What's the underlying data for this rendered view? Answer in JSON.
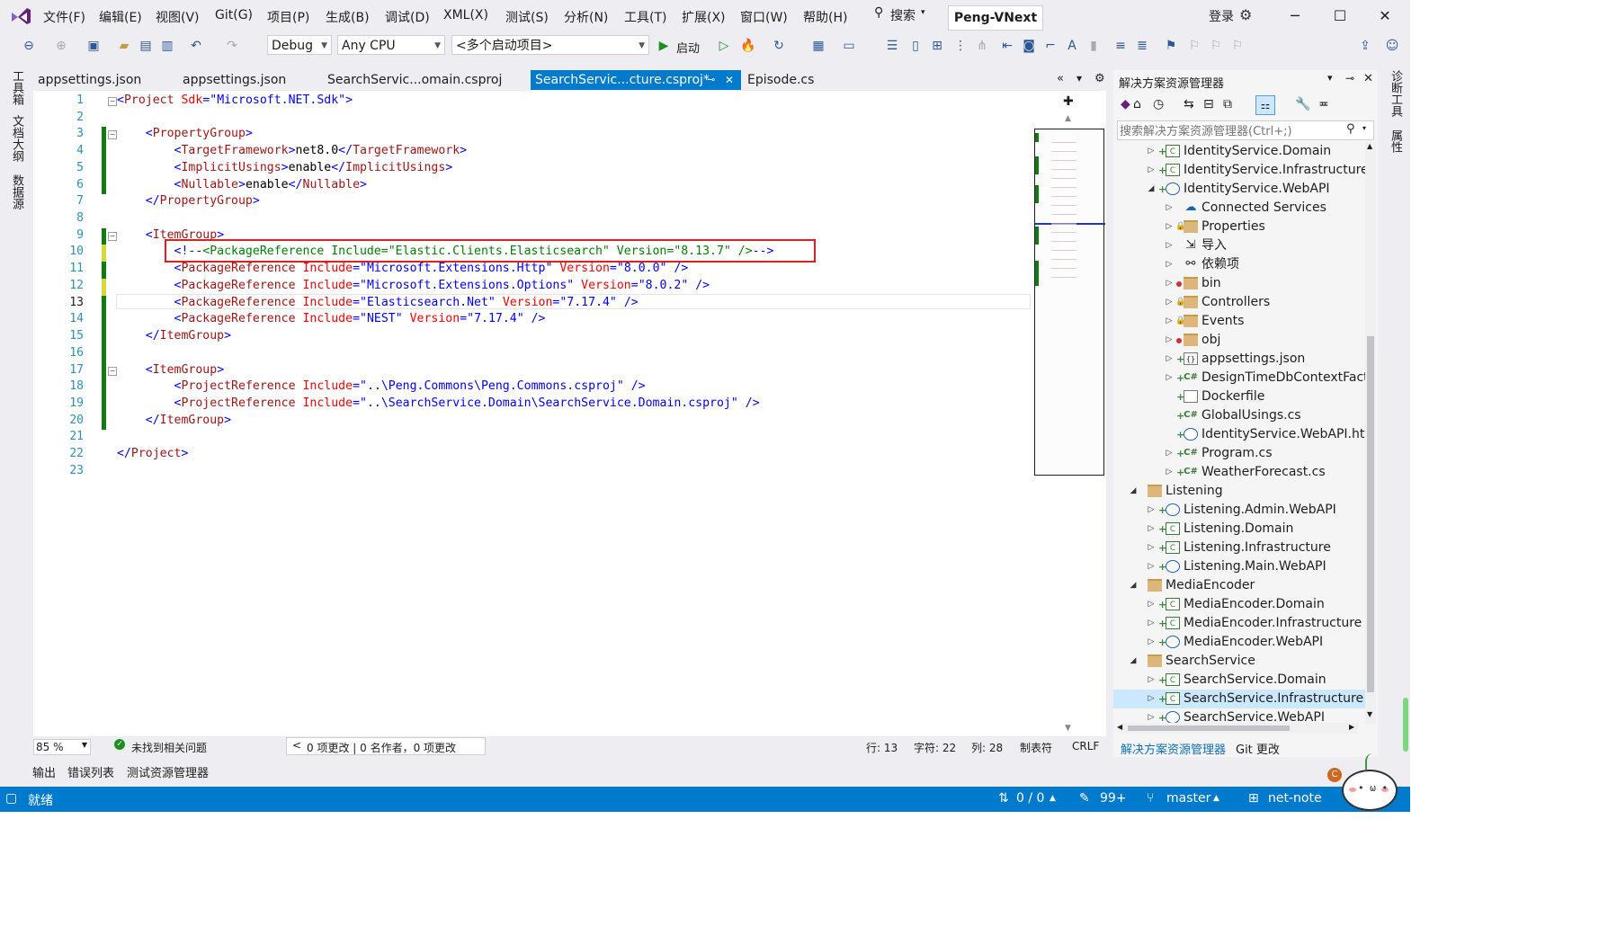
{
  "menu": {
    "items": [
      "文件(F)",
      "编辑(E)",
      "视图(V)",
      "Git(G)",
      "项目(P)",
      "生成(B)",
      "调试(D)",
      "XML(X)",
      "测试(S)",
      "分析(N)",
      "工具(T)",
      "扩展(X)",
      "窗口(W)",
      "帮助(H)"
    ],
    "search": "搜索",
    "solution_name": "Peng-VNext",
    "login": "登录"
  },
  "toolbar": {
    "config": "Debug",
    "platform": "Any CPU",
    "startup": "<多个启动项目>",
    "start_label": "启动"
  },
  "left_strip": {
    "tabs": [
      "工具箱",
      "文档大纲",
      "数据源"
    ]
  },
  "right_strip": {
    "tabs": [
      "诊断工具",
      "属性"
    ]
  },
  "doc_tabs": [
    {
      "label": "appsettings.json"
    },
    {
      "label": "appsettings.json"
    },
    {
      "label": "SearchServic...omain.csproj"
    },
    {
      "label": "SearchServic...cture.csproj*"
    },
    {
      "label": "Episode.cs"
    }
  ],
  "editor": {
    "line_numbers": [
      "1",
      "2",
      "3",
      "4",
      "5",
      "6",
      "7",
      "8",
      "9",
      "10",
      "11",
      "12",
      "13",
      "14",
      "15",
      "16",
      "17",
      "18",
      "19",
      "20",
      "21",
      "22",
      "23"
    ],
    "lines": [
      [
        [
          "br",
          "<"
        ],
        [
          "tag",
          "Project"
        ],
        [
          "attr",
          " Sdk"
        ],
        [
          "br",
          "="
        ],
        [
          "val",
          "\"Microsoft.NET.Sdk\""
        ],
        [
          "br",
          ">"
        ]
      ],
      [],
      [
        [
          "txt",
          "    "
        ],
        [
          "br",
          "<"
        ],
        [
          "tag",
          "PropertyGroup"
        ],
        [
          "br",
          ">"
        ]
      ],
      [
        [
          "txt",
          "        "
        ],
        [
          "br",
          "<"
        ],
        [
          "tag",
          "TargetFramework"
        ],
        [
          "br",
          ">"
        ],
        [
          "txt",
          "net8.0"
        ],
        [
          "br",
          "</"
        ],
        [
          "tag",
          "TargetFramework"
        ],
        [
          "br",
          ">"
        ]
      ],
      [
        [
          "txt",
          "        "
        ],
        [
          "br",
          "<"
        ],
        [
          "tag",
          "ImplicitUsings"
        ],
        [
          "br",
          ">"
        ],
        [
          "txt",
          "enable"
        ],
        [
          "br",
          "</"
        ],
        [
          "tag",
          "ImplicitUsings"
        ],
        [
          "br",
          ">"
        ]
      ],
      [
        [
          "txt",
          "        "
        ],
        [
          "br",
          "<"
        ],
        [
          "tag",
          "Nullable"
        ],
        [
          "br",
          ">"
        ],
        [
          "txt",
          "enable"
        ],
        [
          "br",
          "</"
        ],
        [
          "tag",
          "Nullable"
        ],
        [
          "br",
          ">"
        ]
      ],
      [
        [
          "txt",
          "    "
        ],
        [
          "br",
          "</"
        ],
        [
          "tag",
          "PropertyGroup"
        ],
        [
          "br",
          ">"
        ]
      ],
      [],
      [
        [
          "txt",
          "    "
        ],
        [
          "br",
          "<"
        ],
        [
          "tag",
          "ItemGroup"
        ],
        [
          "br",
          ">"
        ]
      ],
      [
        [
          "txt",
          "        "
        ],
        [
          "br",
          "<!--"
        ],
        [
          "cmt",
          "<PackageReference Include=\"Elastic.Clients.Elasticsearch\" Version=\"8.13.7\" />"
        ],
        [
          "br",
          "-->"
        ]
      ],
      [
        [
          "txt",
          "        "
        ],
        [
          "br",
          "<"
        ],
        [
          "tag",
          "PackageReference"
        ],
        [
          "attr",
          " Include"
        ],
        [
          "br",
          "="
        ],
        [
          "val",
          "\"Microsoft.Extensions.Http\""
        ],
        [
          "attr",
          " Version"
        ],
        [
          "br",
          "="
        ],
        [
          "val",
          "\"8.0.0\""
        ],
        [
          "br",
          " />"
        ]
      ],
      [
        [
          "txt",
          "        "
        ],
        [
          "br",
          "<"
        ],
        [
          "tag",
          "PackageReference"
        ],
        [
          "attr",
          " Include"
        ],
        [
          "br",
          "="
        ],
        [
          "val",
          "\"Microsoft.Extensions.Options\""
        ],
        [
          "attr",
          " Version"
        ],
        [
          "br",
          "="
        ],
        [
          "val",
          "\"8.0.2\""
        ],
        [
          "br",
          " />"
        ]
      ],
      [
        [
          "txt",
          "        "
        ],
        [
          "br",
          "<"
        ],
        [
          "tag",
          "PackageReference"
        ],
        [
          "attr",
          " Include"
        ],
        [
          "br",
          "="
        ],
        [
          "val",
          "\"Elasticsearch.Net\""
        ],
        [
          "attr",
          " Version"
        ],
        [
          "br",
          "="
        ],
        [
          "val",
          "\"7.17.4\""
        ],
        [
          "br",
          " />"
        ]
      ],
      [
        [
          "txt",
          "        "
        ],
        [
          "br",
          "<"
        ],
        [
          "tag",
          "PackageReference"
        ],
        [
          "attr",
          " Include"
        ],
        [
          "br",
          "="
        ],
        [
          "val",
          "\"NEST\""
        ],
        [
          "attr",
          " Version"
        ],
        [
          "br",
          "="
        ],
        [
          "val",
          "\"7.17.4\""
        ],
        [
          "br",
          " />"
        ]
      ],
      [
        [
          "txt",
          "    "
        ],
        [
          "br",
          "</"
        ],
        [
          "tag",
          "ItemGroup"
        ],
        [
          "br",
          ">"
        ]
      ],
      [],
      [
        [
          "txt",
          "    "
        ],
        [
          "br",
          "<"
        ],
        [
          "tag",
          "ItemGroup"
        ],
        [
          "br",
          ">"
        ]
      ],
      [
        [
          "txt",
          "        "
        ],
        [
          "br",
          "<"
        ],
        [
          "tag",
          "ProjectReference"
        ],
        [
          "attr",
          " Include"
        ],
        [
          "br",
          "="
        ],
        [
          "val",
          "\"..\\Peng.Commons\\Peng.Commons.csproj\""
        ],
        [
          "br",
          " />"
        ]
      ],
      [
        [
          "txt",
          "        "
        ],
        [
          "br",
          "<"
        ],
        [
          "tag",
          "ProjectReference"
        ],
        [
          "attr",
          " Include"
        ],
        [
          "br",
          "="
        ],
        [
          "val",
          "\"..\\SearchService.Domain\\SearchService.Domain.csproj\""
        ],
        [
          "br",
          " />"
        ]
      ],
      [
        [
          "txt",
          "    "
        ],
        [
          "br",
          "</"
        ],
        [
          "tag",
          "ItemGroup"
        ],
        [
          "br",
          ">"
        ]
      ],
      [],
      [
        [
          "br",
          "</"
        ],
        [
          "tag",
          "Project"
        ],
        [
          "br",
          ">"
        ]
      ],
      []
    ]
  },
  "editor_status": {
    "zoom": "85 %",
    "issues": "未找到相关问题",
    "changes": "0 项更改 | 0 名作者，0 项更改",
    "line": "行: 13",
    "char": "字符: 22",
    "col": "列: 28",
    "tabs": "制表符",
    "eol": "CRLF"
  },
  "bottom_tabs": [
    "输出",
    "错误列表",
    "测试资源管理器"
  ],
  "solution_explorer": {
    "title": "解决方案资源管理器",
    "search_placeholder": "搜索解决方案资源管理器(Ctrl+;)",
    "items": [
      {
        "label": "IdentityService.Domain"
      },
      {
        "label": "IdentityService.Infrastructure"
      },
      {
        "label": "IdentityService.WebAPI"
      },
      {
        "label": "Connected Services"
      },
      {
        "label": "Properties"
      },
      {
        "label": "导入"
      },
      {
        "label": "依赖项"
      },
      {
        "label": "bin"
      },
      {
        "label": "Controllers"
      },
      {
        "label": "Events"
      },
      {
        "label": "obj"
      },
      {
        "label": "appsettings.json"
      },
      {
        "label": "DesignTimeDbContextFactc"
      },
      {
        "label": "Dockerfile"
      },
      {
        "label": "GlobalUsings.cs"
      },
      {
        "label": "IdentityService.WebAPI.http"
      },
      {
        "label": "Program.cs"
      },
      {
        "label": "WeatherForecast.cs"
      },
      {
        "label": "Listening"
      },
      {
        "label": "Listening.Admin.WebAPI"
      },
      {
        "label": "Listening.Domain"
      },
      {
        "label": "Listening.Infrastructure"
      },
      {
        "label": "Listening.Main.WebAPI"
      },
      {
        "label": "MediaEncoder"
      },
      {
        "label": "MediaEncoder.Domain"
      },
      {
        "label": "MediaEncoder.Infrastructure"
      },
      {
        "label": "MediaEncoder.WebAPI"
      },
      {
        "label": "SearchService"
      },
      {
        "label": "SearchService.Domain"
      },
      {
        "label": "SearchService.Infrastructure"
      },
      {
        "label": "SearchService.WebAPI"
      }
    ],
    "tabs": [
      "解决方案资源管理器",
      "Git 更改"
    ]
  },
  "status_bar": {
    "ready": "就绪",
    "sync": "0 / 0",
    "pending": "99+",
    "branch": "master",
    "repo": "net-note"
  },
  "colors": {
    "accent": "#007acc",
    "highlight_box": "#e02020",
    "change_bar": "#107c10"
  }
}
